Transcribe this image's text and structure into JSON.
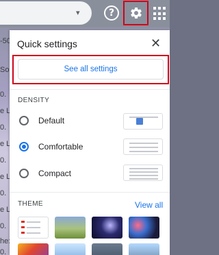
{
  "header": {
    "help_icon": "?",
    "settings_icon": "gear-icon",
    "apps_icon": "grid-icon",
    "caret": "▾"
  },
  "background_snippets": [
    "-50",
    "So",
    "0.",
    "e L",
    "0.",
    "e L",
    "0.",
    "e L",
    "0.",
    "e L",
    "0.",
    "he:",
    "0."
  ],
  "panel": {
    "title": "Quick settings",
    "close": "✕",
    "see_all_label": "See all settings",
    "density": {
      "heading": "DENSITY",
      "options": [
        {
          "label": "Default",
          "selected": false
        },
        {
          "label": "Comfortable",
          "selected": true
        },
        {
          "label": "Compact",
          "selected": false
        }
      ]
    },
    "theme": {
      "heading": "THEME",
      "view_all": "View all"
    }
  },
  "colors": {
    "accent": "#1a73e8",
    "highlight_box": "#d0021b"
  }
}
